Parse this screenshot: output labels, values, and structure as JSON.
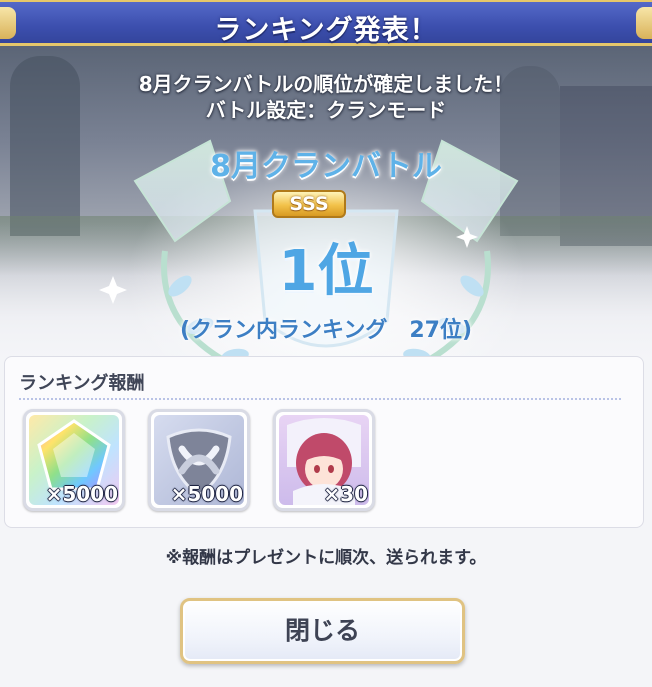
{
  "header": {
    "title": "ランキング発表！"
  },
  "announcement": {
    "line1": "8月クランバトルの順位が確定しました！",
    "line2": "バトル設定：クランモード"
  },
  "result": {
    "battle_name": "8月クランバトル",
    "grade_badge": "SSS",
    "rank": "1位",
    "clan_ranking": "(クラン内ランキング　27位)"
  },
  "rewards": {
    "heading": "ランキング報酬",
    "items": [
      {
        "icon": "rainbow-crystal-icon",
        "quantity": "×5000"
      },
      {
        "icon": "silver-knot-emblem-icon",
        "quantity": "×5000"
      },
      {
        "icon": "character-portrait-icon",
        "quantity": "×30"
      }
    ]
  },
  "note": "※報酬はプレゼントに順次、送られます。",
  "buttons": {
    "close_label": "閉じる"
  },
  "colors": {
    "title_bar": "#3c4fae",
    "title_trim": "#e6c76a",
    "rank_blue": "#4fa6e4",
    "badge_gold": "#f2c24a"
  }
}
